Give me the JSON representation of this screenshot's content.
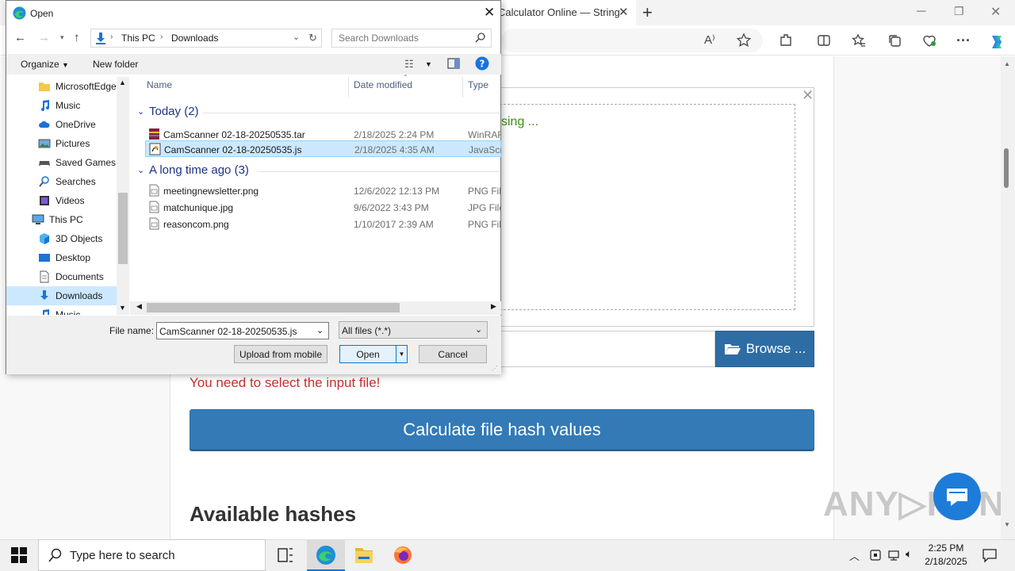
{
  "browser": {
    "tab_title": "Calculator Online — String",
    "new_tab": "+",
    "window_controls": [
      "minimize",
      "restore",
      "close"
    ]
  },
  "page": {
    "processing": "sing ...",
    "browse_label": "Browse ...",
    "error": "You need to select the input file!",
    "calc_button": "Calculate file hash values",
    "available_heading": "Available hashes",
    "watermark": "ANY RUN"
  },
  "dialog": {
    "title": "Open",
    "breadcrumb": [
      "This PC",
      "Downloads"
    ],
    "search_placeholder": "Search Downloads",
    "organize": "Organize",
    "new_folder": "New folder",
    "nav_items": [
      {
        "label": "MicrosoftEdge",
        "icon": "folder-icon"
      },
      {
        "label": "Music",
        "icon": "music-icon"
      },
      {
        "label": "OneDrive",
        "icon": "onedrive-icon"
      },
      {
        "label": "Pictures",
        "icon": "pictures-icon"
      },
      {
        "label": "Saved Games",
        "icon": "saved-games-icon"
      },
      {
        "label": "Searches",
        "icon": "searches-icon"
      },
      {
        "label": "Videos",
        "icon": "videos-icon"
      },
      {
        "label": "This PC",
        "icon": "this-pc-icon"
      },
      {
        "label": "3D Objects",
        "icon": "3d-objects-icon"
      },
      {
        "label": "Desktop",
        "icon": "desktop-icon"
      },
      {
        "label": "Documents",
        "icon": "documents-icon"
      },
      {
        "label": "Downloads",
        "icon": "downloads-icon"
      },
      {
        "label": "Music",
        "icon": "music-icon"
      }
    ],
    "columns": {
      "name": "Name",
      "date": "Date modified",
      "type": "Type"
    },
    "groups": [
      {
        "label": "Today (2)",
        "files": [
          {
            "name": "CamScanner 02-18-20250535.tar",
            "date": "2/18/2025 2:24 PM",
            "type": "WinRAR",
            "icon": "winrar-icon"
          },
          {
            "name": "CamScanner 02-18-20250535.js",
            "date": "2/18/2025 4:35 AM",
            "type": "JavaScri",
            "icon": "script-file-icon",
            "selected": true
          }
        ]
      },
      {
        "label": "A long time ago (3)",
        "files": [
          {
            "name": "meetingnewsletter.png",
            "date": "12/6/2022 12:13 PM",
            "type": "PNG File",
            "icon": "image-file-icon"
          },
          {
            "name": "matchunique.jpg",
            "date": "9/6/2022 3:43 PM",
            "type": "JPG File",
            "icon": "image-file-icon"
          },
          {
            "name": "reasoncom.png",
            "date": "1/10/2017 2:39 AM",
            "type": "PNG File",
            "icon": "image-file-icon"
          }
        ]
      }
    ],
    "file_name_label": "File name:",
    "file_name_value": "CamScanner 02-18-20250535.js",
    "filter_value": "All files (*.*)",
    "upload_mobile": "Upload from mobile",
    "open_button": "Open",
    "cancel_button": "Cancel"
  },
  "taskbar": {
    "search_placeholder": "Type here to search",
    "time": "2:25 PM",
    "date": "2/18/2025"
  },
  "colors": {
    "accent": "#337ab7",
    "error": "#c9302c",
    "selection": "#cce8ff",
    "processing": "#3c8d14"
  }
}
